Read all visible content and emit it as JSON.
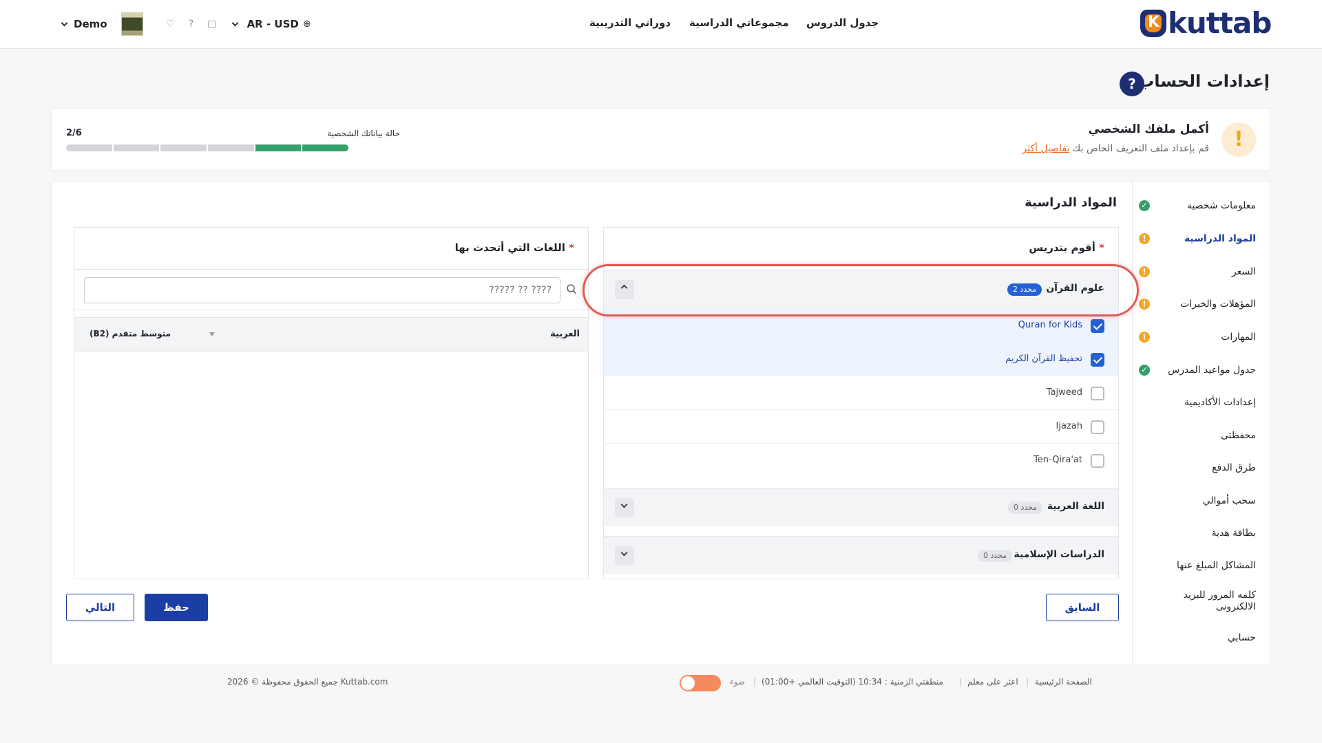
{
  "header": {
    "logo_text": "kuttab",
    "logo_letter": "K",
    "nav": [
      "جدول الدروس",
      "مجموعاتي الدراسية",
      "دوراتي التدريبية"
    ],
    "lang_currency": "AR - USD",
    "user_name": "Demo"
  },
  "page": {
    "title": "إعدادات الحساب"
  },
  "banner": {
    "title": "أكمل ملفك الشخصي",
    "subtitle": "قم بإعداد ملف التعريف الخاص بك",
    "link": "تفاصيل أكثر",
    "progress_label": "حالة بياناتك الشخصية",
    "progress_count": "2/6",
    "progress_done": 2,
    "progress_total": 6
  },
  "sidebar": {
    "items": [
      {
        "label": "معلومات شخصية",
        "status": "ok"
      },
      {
        "label": "المواد الدراسية",
        "status": "warn",
        "active": true
      },
      {
        "label": "السعر",
        "status": "warn"
      },
      {
        "label": "المؤهلات والخبرات",
        "status": "warn"
      },
      {
        "label": "المهارات",
        "status": "warn"
      },
      {
        "label": "جدول مواعيد المدرس",
        "status": "ok"
      },
      {
        "label": "إعدادات الأكاديمية"
      },
      {
        "label": "محفظتى"
      },
      {
        "label": "طرق الدفع"
      },
      {
        "label": "سحب أموالي"
      },
      {
        "label": "بطاقة هدية"
      },
      {
        "label": "المشاكل المبلغ عنها"
      },
      {
        "label": "كلمه المرور للبريد الالكترونى"
      },
      {
        "label": "حسابي"
      }
    ]
  },
  "subjects": {
    "section_title": "المواد الدراسية",
    "teach_label": "أقوم بتدريس",
    "required_mark": "*",
    "groups": [
      {
        "title": "علوم القرآن",
        "count": "2 محدد",
        "expanded": true
      },
      {
        "title": "اللغة العربية",
        "count": "0 محدد",
        "expanded": false
      },
      {
        "title": "الدراسات الإسلامية",
        "count": "0 محدد",
        "expanded": false
      }
    ],
    "options": [
      {
        "label": "Quran for Kids",
        "checked": true
      },
      {
        "label": "تحفيظ القرآن الكريم",
        "checked": true
      },
      {
        "label": "Tajweed",
        "checked": false
      },
      {
        "label": "Ijazah",
        "checked": false
      },
      {
        "label": "Ten-Qira'at",
        "checked": false
      }
    ]
  },
  "languages": {
    "label": "اللغات التي أتحدث بها",
    "search_placeholder": "????? ?? ????",
    "rows": [
      {
        "name": "العربية",
        "level": "متوسط متقدم (B2)"
      }
    ]
  },
  "buttons": {
    "prev": "السابق",
    "save": "حفظ",
    "next": "التالي"
  },
  "footer": {
    "home": "الصفحة الرئيسية",
    "find_teacher": "اعثر على معلم",
    "timezone": "منطقتي الزمنية : 10:34 (التوقيت العالمي +01:00)",
    "theme_label": "ضوء",
    "copyright": "جميع الحقوق محفوظة © 2026 Kuttab.com"
  },
  "colors": {
    "brand": "#1d2e72",
    "accent_orange": "#f08a1c",
    "primary_button": "#1b3ea5",
    "success": "#35a06a",
    "warning": "#f5a623",
    "highlight_ring": "#e05a55"
  }
}
